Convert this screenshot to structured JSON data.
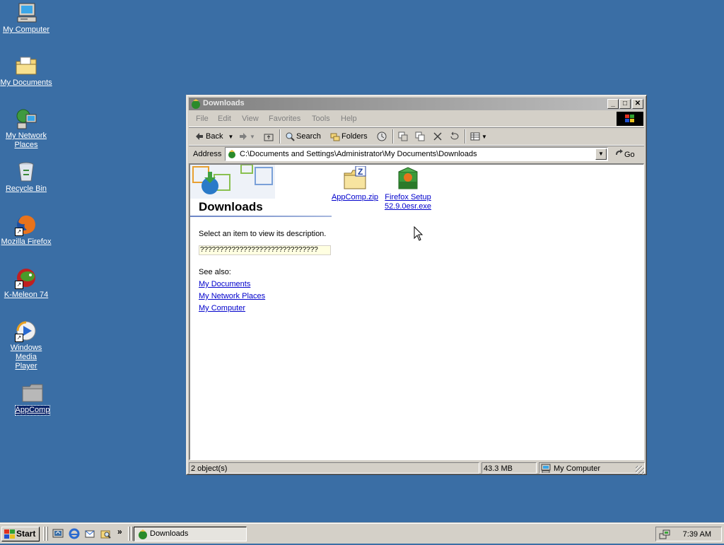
{
  "desktop": {
    "icons": [
      {
        "label": "My Computer",
        "icon": "computer-icon"
      },
      {
        "label": "My Documents",
        "icon": "documents-folder-icon"
      },
      {
        "label": "My Network Places",
        "icon": "network-places-icon"
      },
      {
        "label": "Recycle Bin",
        "icon": "recycle-bin-icon"
      },
      {
        "label": "Mozilla Firefox",
        "icon": "firefox-icon"
      },
      {
        "label": "K-Meleon 74",
        "icon": "kmeleon-icon"
      },
      {
        "label": "Windows Media Player",
        "icon": "media-player-icon"
      },
      {
        "label": "AppComp",
        "icon": "folder-icon"
      }
    ]
  },
  "window": {
    "title": "Downloads",
    "menu": [
      "File",
      "Edit",
      "View",
      "Favorites",
      "Tools",
      "Help"
    ],
    "toolbar": {
      "back": "Back",
      "search": "Search",
      "folders": "Folders"
    },
    "address": {
      "label": "Address",
      "value": "C:\\Documents and Settings\\Administrator\\My Documents\\Downloads",
      "go": "Go"
    },
    "left_pane": {
      "title": "Downloads",
      "description": "Select an item to view its description.",
      "unknown_text": "??????????????????????????????",
      "see_also_label": "See also:",
      "links": [
        "My Documents",
        "My Network Places",
        "My Computer"
      ]
    },
    "files": [
      {
        "name": "AppComp.zip",
        "icon": "zip-folder-icon"
      },
      {
        "name": "Firefox Setup 52.9.0esr.exe",
        "icon": "setup-package-icon"
      }
    ],
    "status": {
      "objects": "2 object(s)",
      "size": "43.3 MB",
      "zone": "My Computer"
    }
  },
  "taskbar": {
    "start": "Start",
    "task": "Downloads",
    "clock": "7:39 AM",
    "chevron": "»"
  },
  "colors": {
    "desktop": "#3a6ea5",
    "inactive_title": "#808080",
    "link": "#0000cc"
  }
}
